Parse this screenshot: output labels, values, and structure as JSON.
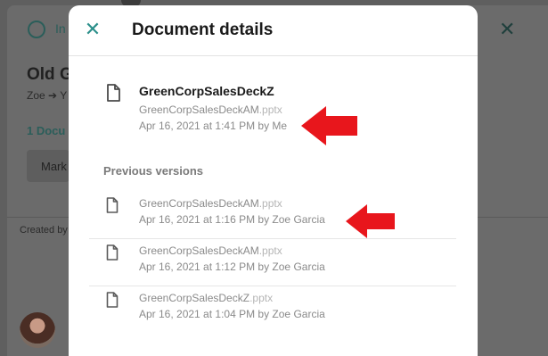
{
  "background": {
    "header_label": "In",
    "page_title": "Old G",
    "path_from": "Zoe",
    "path_arrow": "➔",
    "path_to": "Y",
    "docs_count": "1 Docu",
    "mark_button": "Mark",
    "created_by": "Created by"
  },
  "modal": {
    "close_glyph": "✕",
    "title": "Document details",
    "current": {
      "name": "GreenCorpSalesDeckZ",
      "file_base": "GreenCorpSalesDeckAM",
      "file_ext": ".pptx",
      "meta": "Apr 16, 2021 at 1:41 PM by Me"
    },
    "previous_heading": "Previous versions",
    "versions": [
      {
        "file_base": "GreenCorpSalesDeckAM",
        "file_ext": ".pptx",
        "meta": "Apr 16, 2021 at 1:16 PM by Zoe Garcia"
      },
      {
        "file_base": "GreenCorpSalesDeckAM",
        "file_ext": ".pptx",
        "meta": "Apr 16, 2021 at 1:12 PM by Zoe Garcia"
      },
      {
        "file_base": "GreenCorpSalesDeckZ",
        "file_ext": ".pptx",
        "meta": "Apr 16, 2021 at 1:04 PM by Zoe Garcia"
      }
    ]
  },
  "colors": {
    "accent": "#2b8f8a",
    "annotation_arrow": "#e8161c",
    "overlay": "#5f5f5f"
  },
  "icons": [
    "close-icon",
    "document-icon",
    "arrow-annotation-icon",
    "more-dots-icon"
  ]
}
